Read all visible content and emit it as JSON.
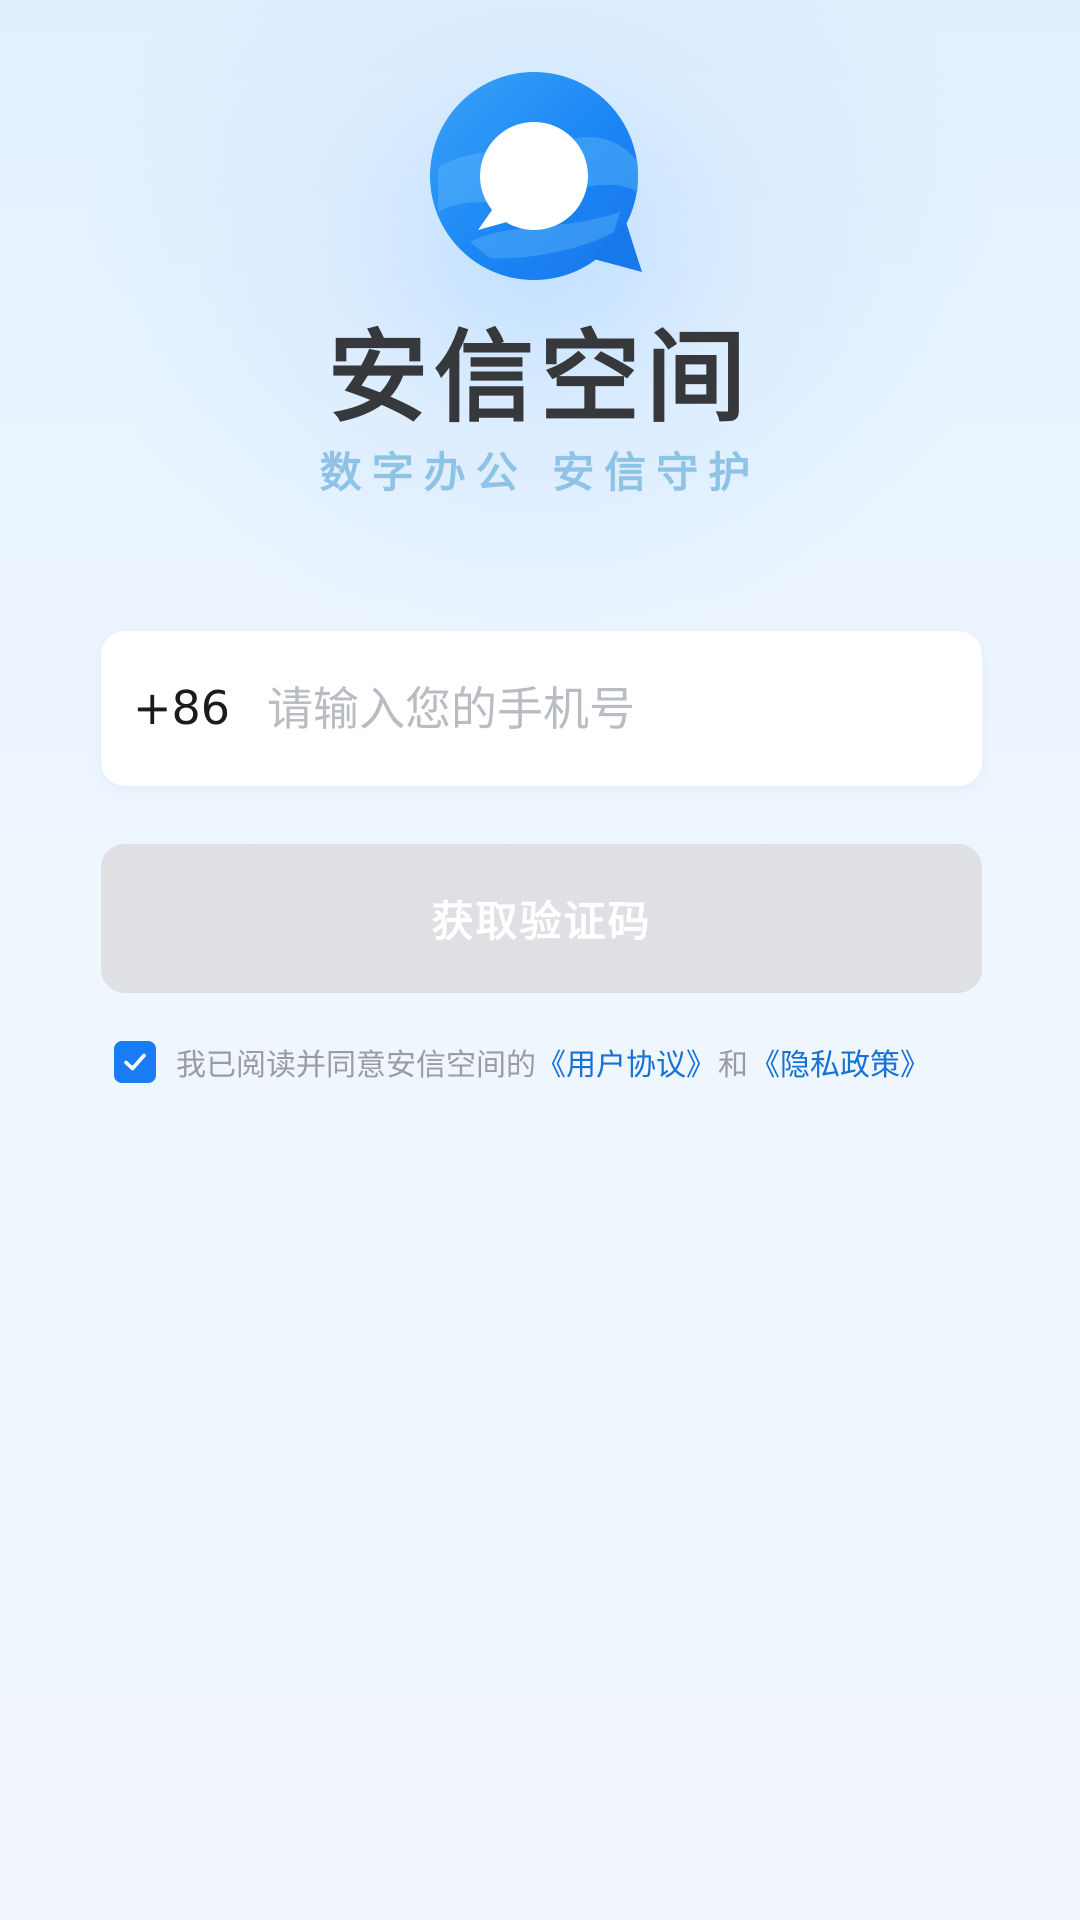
{
  "brand": {
    "app_name": "安信空间",
    "slogan": "数字办公 安信守护"
  },
  "login": {
    "country_code": "+86",
    "phone_placeholder": "请输入您的手机号",
    "phone_value": "",
    "submit_label": "获取验证码"
  },
  "agreement": {
    "checked": true,
    "text": "我已阅读并同意安信空间的",
    "user_agreement": "《用户协议》",
    "and": "和",
    "privacy_policy": "《隐私政策》"
  },
  "colors": {
    "accent": "#1a7cf5",
    "link": "#1673d6",
    "disabled_button": "#dfe0e3"
  },
  "icons": {
    "logo": "chat-bubble-logo-icon",
    "checkbox": "checkmark-icon"
  }
}
